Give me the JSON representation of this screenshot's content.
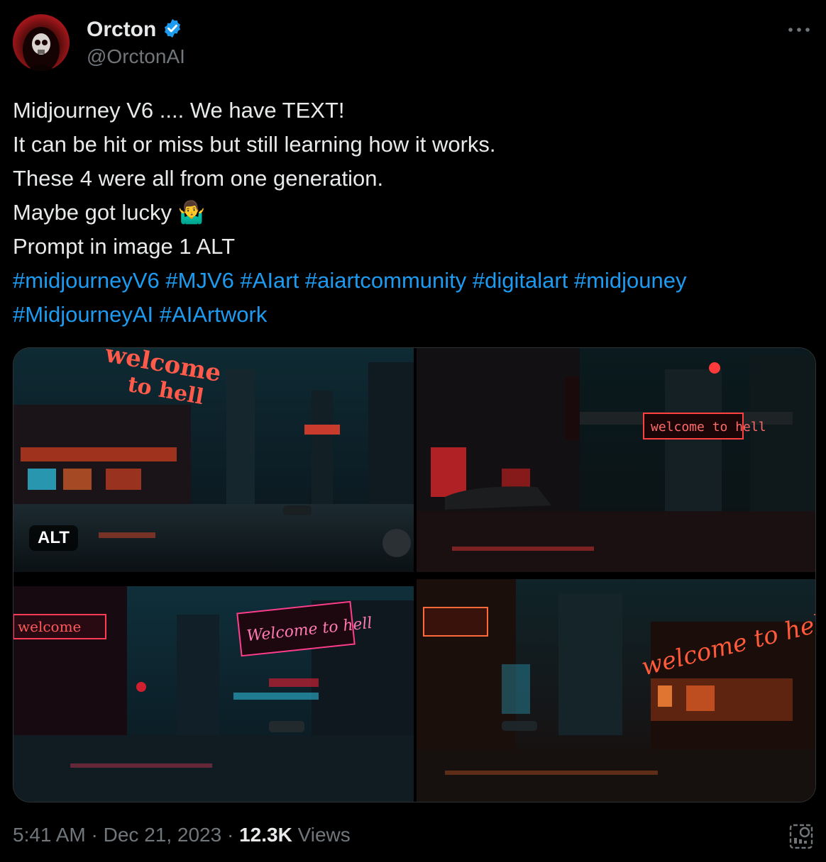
{
  "author": {
    "name": "Orcton",
    "handle": "@OrctonAI",
    "verified": true,
    "verified_color": "#1d9bf0"
  },
  "tweet": {
    "lines": [
      "Midjourney V6 .... We have TEXT!",
      "It can be hit or miss but still learning how it works.",
      "These 4 were all from one generation.",
      "Maybe got lucky",
      "Prompt in image 1 ALT"
    ],
    "emoji": "🤷‍♂️",
    "hashtags_line1": [
      "#midjourneyV6",
      "#MJV6",
      "#AIart",
      "#aiartcommunity",
      "#digitalart",
      "#midjouney"
    ],
    "hashtags_line2": [
      "#MidjourneyAI",
      "#AIArtwork"
    ],
    "hashtag_color": "#1d9bf0"
  },
  "media": {
    "alt_badge": "ALT",
    "images": [
      {
        "sign_text_1": "welcome",
        "sign_text_2": "to hell"
      },
      {
        "sign_text": "welcome to hell"
      },
      {
        "sign_text": "Welcome to hell",
        "side_sign": "welcome"
      },
      {
        "sign_text": "welcome to hell"
      }
    ]
  },
  "meta": {
    "time": "5:41 AM",
    "date": "Dec 21, 2023",
    "views_count": "12.3K",
    "views_label": "Views"
  },
  "icons": {
    "more": "more-icon",
    "verified": "verified-badge-icon",
    "stats": "post-analytics-icon"
  }
}
